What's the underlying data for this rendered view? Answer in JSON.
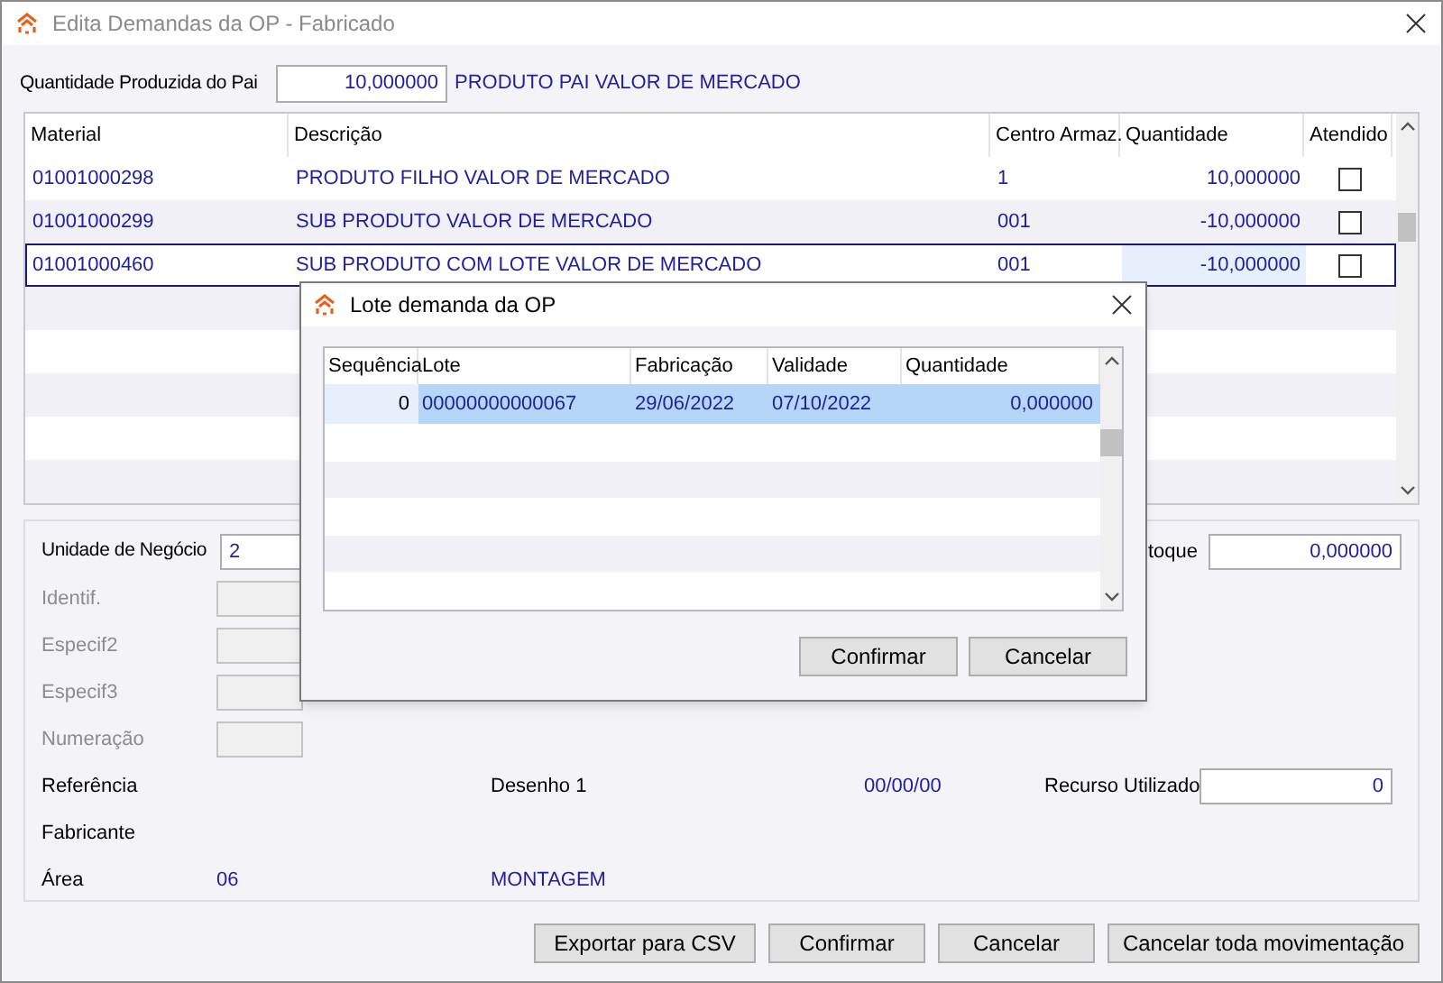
{
  "window": {
    "title": "Edita Demandas da OP - Fabricado"
  },
  "parent_quantity": {
    "label": "Quantidade Produzida do Pai",
    "value": "10,000000",
    "product": "PRODUTO PAI VALOR DE MERCADO"
  },
  "table": {
    "columns": [
      "Material",
      "Descrição",
      "Centro Armaz.",
      "Quantidade",
      "Atendido"
    ],
    "rows": [
      {
        "material": "01001000298",
        "descricao": "PRODUTO FILHO VALOR DE MERCADO",
        "centro": "1",
        "quantidade": "10,000000",
        "checked": false,
        "selected": false
      },
      {
        "material": "01001000299",
        "descricao": "SUB PRODUTO VALOR DE MERCADO",
        "centro": "001",
        "quantidade": "-10,000000",
        "checked": false,
        "selected": false
      },
      {
        "material": "01001000460",
        "descricao": "SUB PRODUTO COM LOTE VALOR DE MERCADO",
        "centro": "001",
        "quantidade": "-10,000000",
        "checked": false,
        "selected": true
      }
    ]
  },
  "details": {
    "unidade": {
      "label": "Unidade de Negócio",
      "value": "2"
    },
    "disabled_fields": [
      {
        "label": "Identif."
      },
      {
        "label": "Especif2"
      },
      {
        "label": "Especif3"
      },
      {
        "label": "Numeração"
      }
    ],
    "estoque": {
      "label": "toque",
      "value": "0,000000"
    },
    "referencia": {
      "label": "Referência"
    },
    "desenho": {
      "label": "Desenho 1",
      "value": "00/00/00"
    },
    "recurso": {
      "label": "Recurso Utilizado",
      "value": "0"
    },
    "fabricante": {
      "label": "Fabricante"
    },
    "area": {
      "label": "Área",
      "code": "06",
      "name": "MONTAGEM"
    }
  },
  "buttons": [
    "Exportar para CSV",
    "Confirmar",
    "Cancelar",
    "Cancelar toda movimentação"
  ],
  "dialog": {
    "title": "Lote demanda da OP",
    "columns": [
      "Sequência",
      "Lote",
      "Fabricação",
      "Validade",
      "Quantidade"
    ],
    "rows": [
      {
        "sequencia": "0",
        "lote": "00000000000067",
        "fabricacao": "29/06/2022",
        "validade": "07/10/2022",
        "quantidade": "0,000000",
        "selected": true
      }
    ],
    "buttons": [
      "Confirmar",
      "Cancelar"
    ]
  }
}
